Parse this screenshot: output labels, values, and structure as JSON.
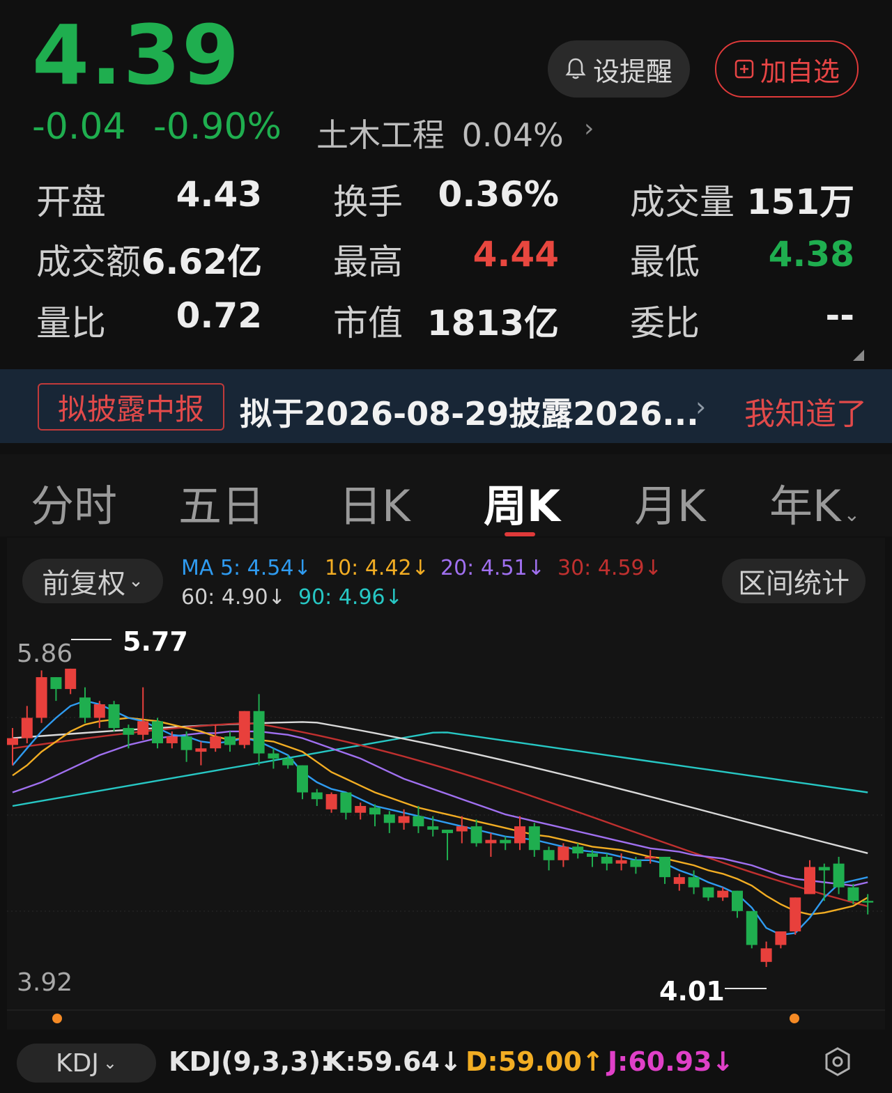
{
  "quote": {
    "price": "4.39",
    "change": "-0.04",
    "change_pct": "-0.90%",
    "sector_name": "土木工程",
    "sector_pct": "0.04%"
  },
  "actions": {
    "alert": "设提醒",
    "add": "加自选"
  },
  "stats": [
    {
      "label": "开盘",
      "value": "4.43",
      "color": "#ededed"
    },
    {
      "label": "换手",
      "value": "0.36%",
      "color": "#ededed"
    },
    {
      "label": "成交量",
      "value": "151万",
      "color": "#ededed"
    },
    {
      "label": "成交额",
      "value": "6.62亿",
      "color": "#ededed"
    },
    {
      "label": "最高",
      "value": "4.44",
      "color": "#e8473f"
    },
    {
      "label": "最低",
      "value": "4.38",
      "color": "#1fae4f"
    },
    {
      "label": "量比",
      "value": "0.72",
      "color": "#ededed"
    },
    {
      "label": "市值",
      "value": "1813亿",
      "color": "#ededed"
    },
    {
      "label": "委比",
      "value": "--",
      "color": "#ededed"
    }
  ],
  "notice": {
    "tag": "拟披露中报",
    "text": "拟于2026-08-29披露2026...",
    "dismiss": "我知道了"
  },
  "tabs": [
    "分时",
    "五日",
    "日K",
    "周K",
    "月K",
    "年K"
  ],
  "active_tab": "周K",
  "chart_controls": {
    "adjust": "前复权",
    "range_stats": "区间统计"
  },
  "ma": {
    "ma5": "MA 5: 4.54↓",
    "ma10": "10: 4.42↓",
    "ma20": "20: 4.51↓",
    "ma30": "30: 4.59↓",
    "ma60": "60: 4.90↓",
    "ma90": "90: 4.96↓"
  },
  "colors": {
    "up": "#e8403c",
    "down": "#1fae4f",
    "ma5": "#2f9bf0",
    "ma10": "#f2ad23",
    "ma20": "#a070f0",
    "ma30": "#c0302f",
    "ma60": "#d9d9d9",
    "ma90": "#27c7c4"
  },
  "chart_data": {
    "type": "candlestick",
    "y_top_label": "5.86",
    "y_bottom_label": "3.92",
    "ylim": [
      3.92,
      5.86
    ],
    "high_marker": "5.77",
    "low_marker": "4.01",
    "candles": [
      [
        5.32,
        5.36,
        5.2,
        5.42
      ],
      [
        5.36,
        5.48,
        5.33,
        5.55
      ],
      [
        5.48,
        5.72,
        5.45,
        5.76
      ],
      [
        5.72,
        5.65,
        5.58,
        5.72
      ],
      [
        5.65,
        5.77,
        5.62,
        5.77
      ],
      [
        5.6,
        5.48,
        5.45,
        5.66
      ],
      [
        5.48,
        5.56,
        5.42,
        5.58
      ],
      [
        5.56,
        5.42,
        5.4,
        5.58
      ],
      [
        5.42,
        5.38,
        5.3,
        5.44
      ],
      [
        5.38,
        5.46,
        5.35,
        5.66
      ],
      [
        5.46,
        5.33,
        5.3,
        5.48
      ],
      [
        5.33,
        5.37,
        5.3,
        5.4
      ],
      [
        5.37,
        5.29,
        5.22,
        5.4
      ],
      [
        5.28,
        5.3,
        5.2,
        5.34
      ],
      [
        5.3,
        5.37,
        5.28,
        5.44
      ],
      [
        5.37,
        5.32,
        5.28,
        5.4
      ],
      [
        5.32,
        5.52,
        5.3,
        5.52
      ],
      [
        5.52,
        5.27,
        5.2,
        5.62
      ],
      [
        5.27,
        5.24,
        5.18,
        5.3
      ],
      [
        5.24,
        5.2,
        5.18,
        5.26
      ],
      [
        5.2,
        5.04,
        5.0,
        5.2
      ],
      [
        5.04,
        5.0,
        4.96,
        5.06
      ],
      [
        4.94,
        5.03,
        4.92,
        5.04
      ],
      [
        5.04,
        4.92,
        4.88,
        5.04
      ],
      [
        4.92,
        4.96,
        4.88,
        4.98
      ],
      [
        4.95,
        4.91,
        4.84,
        4.97
      ],
      [
        4.91,
        4.86,
        4.8,
        4.93
      ],
      [
        4.86,
        4.9,
        4.82,
        4.94
      ],
      [
        4.9,
        4.84,
        4.8,
        4.96
      ],
      [
        4.84,
        4.82,
        4.78,
        4.9
      ],
      [
        4.82,
        4.8,
        4.64,
        4.82
      ],
      [
        4.81,
        4.84,
        4.74,
        4.9
      ],
      [
        4.84,
        4.74,
        4.72,
        4.88
      ],
      [
        4.74,
        4.76,
        4.66,
        4.8
      ],
      [
        4.76,
        4.74,
        4.7,
        4.78
      ],
      [
        4.74,
        4.84,
        4.7,
        4.9
      ],
      [
        4.84,
        4.7,
        4.66,
        4.86
      ],
      [
        4.7,
        4.64,
        4.58,
        4.72
      ],
      [
        4.64,
        4.72,
        4.6,
        4.74
      ],
      [
        4.72,
        4.68,
        4.65,
        4.74
      ],
      [
        4.68,
        4.66,
        4.6,
        4.7
      ],
      [
        4.66,
        4.62,
        4.58,
        4.68
      ],
      [
        4.62,
        4.64,
        4.58,
        4.68
      ],
      [
        4.64,
        4.6,
        4.56,
        4.66
      ],
      [
        4.65,
        4.66,
        4.62,
        4.7
      ],
      [
        4.66,
        4.54,
        4.5,
        4.66
      ],
      [
        4.5,
        4.54,
        4.46,
        4.56
      ],
      [
        4.54,
        4.48,
        4.44,
        4.58
      ],
      [
        4.48,
        4.42,
        4.4,
        4.48
      ],
      [
        4.42,
        4.46,
        4.4,
        4.48
      ],
      [
        4.46,
        4.34,
        4.3,
        4.46
      ],
      [
        4.34,
        4.14,
        4.12,
        4.34
      ],
      [
        4.04,
        4.12,
        4.01,
        4.16
      ],
      [
        4.14,
        4.22,
        4.12,
        4.22
      ],
      [
        4.22,
        4.42,
        4.2,
        4.42
      ],
      [
        4.44,
        4.6,
        4.44,
        4.64
      ],
      [
        4.6,
        4.58,
        4.4,
        4.62
      ],
      [
        4.62,
        4.48,
        4.44,
        4.66
      ],
      [
        4.48,
        4.4,
        4.38,
        4.5
      ],
      [
        4.4,
        4.39,
        4.32,
        4.44
      ]
    ],
    "ma5": [
      5.2,
      5.3,
      5.4,
      5.48,
      5.55,
      5.58,
      5.56,
      5.52,
      5.48,
      5.46,
      5.42,
      5.38,
      5.37,
      5.34,
      5.33,
      5.34,
      5.36,
      5.34,
      5.3,
      5.26,
      5.16,
      5.1,
      5.06,
      5.04,
      5.0,
      4.96,
      4.94,
      4.92,
      4.9,
      4.88,
      4.86,
      4.84,
      4.82,
      4.8,
      4.78,
      4.77,
      4.76,
      4.74,
      4.72,
      4.7,
      4.69,
      4.68,
      4.66,
      4.64,
      4.64,
      4.62,
      4.58,
      4.55,
      4.51,
      4.48,
      4.44,
      4.36,
      4.24,
      4.2,
      4.21,
      4.3,
      4.42,
      4.5,
      4.52,
      4.54
    ],
    "ma10": [
      5.14,
      5.2,
      5.28,
      5.34,
      5.4,
      5.44,
      5.46,
      5.47,
      5.48,
      5.47,
      5.46,
      5.44,
      5.42,
      5.4,
      5.37,
      5.35,
      5.36,
      5.35,
      5.34,
      5.31,
      5.28,
      5.22,
      5.16,
      5.12,
      5.08,
      5.04,
      5.01,
      4.98,
      4.95,
      4.93,
      4.91,
      4.89,
      4.87,
      4.85,
      4.83,
      4.81,
      4.79,
      4.78,
      4.76,
      4.74,
      4.72,
      4.71,
      4.7,
      4.68,
      4.66,
      4.65,
      4.63,
      4.61,
      4.58,
      4.56,
      4.53,
      4.49,
      4.43,
      4.38,
      4.34,
      4.32,
      4.33,
      4.35,
      4.37,
      4.42
    ],
    "ma20": [
      5.04,
      5.07,
      5.1,
      5.14,
      5.18,
      5.22,
      5.26,
      5.29,
      5.32,
      5.34,
      5.36,
      5.37,
      5.38,
      5.39,
      5.39,
      5.4,
      5.4,
      5.4,
      5.39,
      5.38,
      5.36,
      5.33,
      5.3,
      5.27,
      5.24,
      5.2,
      5.16,
      5.12,
      5.09,
      5.06,
      5.03,
      5.0,
      4.97,
      4.94,
      4.91,
      4.89,
      4.87,
      4.85,
      4.83,
      4.81,
      4.79,
      4.77,
      4.75,
      4.73,
      4.71,
      4.7,
      4.69,
      4.67,
      4.66,
      4.65,
      4.63,
      4.61,
      4.58,
      4.55,
      4.53,
      4.52,
      4.51,
      4.5,
      4.49,
      4.51
    ]
  },
  "kdj": {
    "selector": "KDJ",
    "params": "KDJ(9,3,3):",
    "k": "K:59.64↓",
    "d": "D:59.00↑",
    "j": "J:60.93↓"
  }
}
